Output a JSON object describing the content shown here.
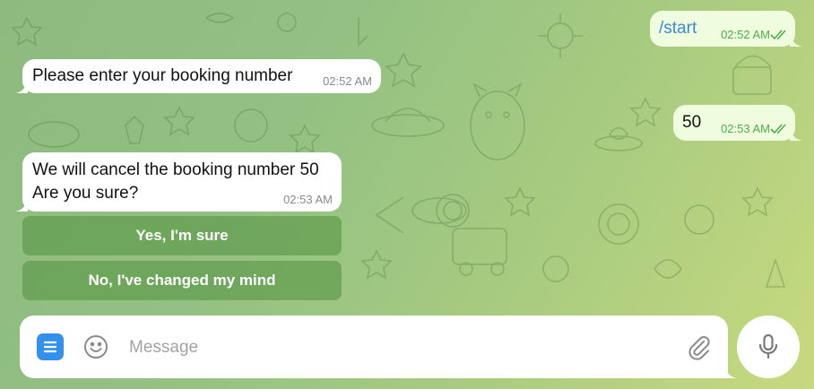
{
  "theme": {
    "incoming_bubble": "#ffffff",
    "outgoing_bubble": "#effdde",
    "accent": "#3390ec",
    "outgoing_time_color": "#4fae4e",
    "keyboard_button_color": "#5a9646"
  },
  "messages": [
    {
      "direction": "out",
      "text": "/start",
      "time": "02:52 AM",
      "status": "read"
    },
    {
      "direction": "in",
      "text": "Please enter your booking number",
      "time": "02:52 AM"
    },
    {
      "direction": "out",
      "text": "50",
      "time": "02:53 AM",
      "status": "read"
    },
    {
      "direction": "in",
      "lines": [
        "We will cancel the booking number 50",
        "Are you sure?"
      ],
      "time": "02:53 AM"
    }
  ],
  "inline_keyboard": [
    {
      "label": "Yes, I'm sure"
    },
    {
      "label": "No, I've changed my mind"
    }
  ],
  "composer": {
    "placeholder": "Message",
    "value": "",
    "menu_icon": "menu-icon",
    "emoji_icon": "smile-icon",
    "attach_icon": "paperclip-icon",
    "send_icon": "microphone-icon"
  }
}
